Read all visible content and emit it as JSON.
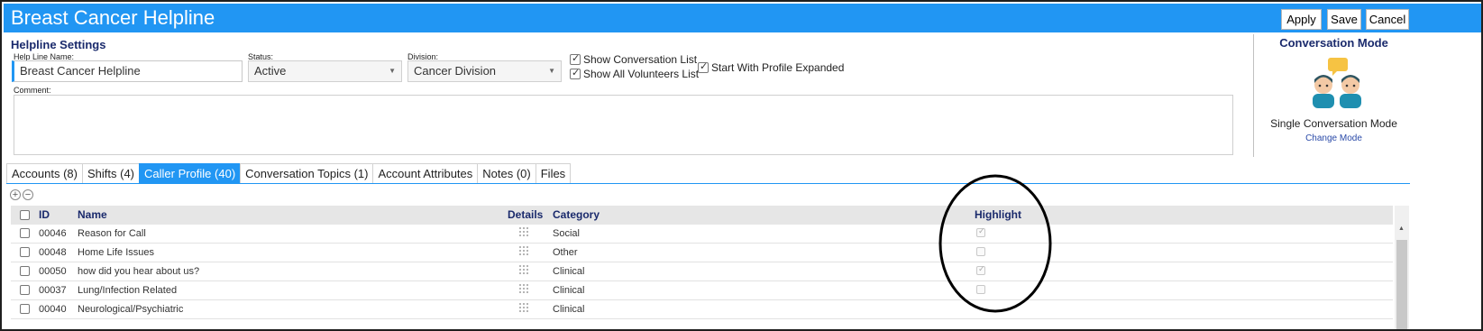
{
  "window": {
    "title": "Breast Cancer Helpline",
    "buttons": {
      "apply": "Apply",
      "save": "Save",
      "cancel": "Cancel"
    }
  },
  "settings": {
    "section_title": "Helpline Settings",
    "helpline_name_label": "Help Line Name:",
    "helpline_name_value": "Breast Cancer Helpline",
    "status_label": "Status:",
    "status_value": "Active",
    "division_label": "Division:",
    "division_value": "Cancer Division",
    "show_conversation_list": {
      "label": "Show Conversation List",
      "checked": true
    },
    "show_all_volunteers_list": {
      "label": "Show All Volunteers List",
      "checked": true
    },
    "start_with_profile_expanded": {
      "label": "Start With Profile Expanded",
      "checked": true
    },
    "comment_label": "Comment:",
    "comment_value": ""
  },
  "conversation_mode": {
    "title": "Conversation Mode",
    "icon": "two-people-chat-icon",
    "mode_label": "Single Conversation Mode",
    "change_link": "Change Mode"
  },
  "tabs": [
    {
      "label": "Accounts (8)",
      "active": false
    },
    {
      "label": "Shifts (4)",
      "active": false
    },
    {
      "label": "Caller Profile (40)",
      "active": true
    },
    {
      "label": "Conversation Topics (1)",
      "active": false
    },
    {
      "label": "Account Attributes",
      "active": false
    },
    {
      "label": "Notes (0)",
      "active": false
    },
    {
      "label": "Files",
      "active": false
    }
  ],
  "grid": {
    "columns": {
      "id": "ID",
      "name": "Name",
      "details": "Details",
      "category": "Category",
      "highlight": "Highlight"
    },
    "rows": [
      {
        "id": "00046",
        "name": "Reason for Call",
        "category": "Social",
        "highlight": true
      },
      {
        "id": "00048",
        "name": "Home Life Issues",
        "category": "Other",
        "highlight": false
      },
      {
        "id": "00050",
        "name": "how did you hear about us?",
        "category": "Clinical",
        "highlight": true
      },
      {
        "id": "00037",
        "name": "Lung/Infection Related",
        "category": "Clinical",
        "highlight": false
      },
      {
        "id": "00040",
        "name": "Neurological/Psychiatric",
        "category": "Clinical",
        "highlight": false
      }
    ]
  },
  "colors": {
    "accent": "#2196f3",
    "heading": "#1a2a6c",
    "annotation": "#000000"
  }
}
